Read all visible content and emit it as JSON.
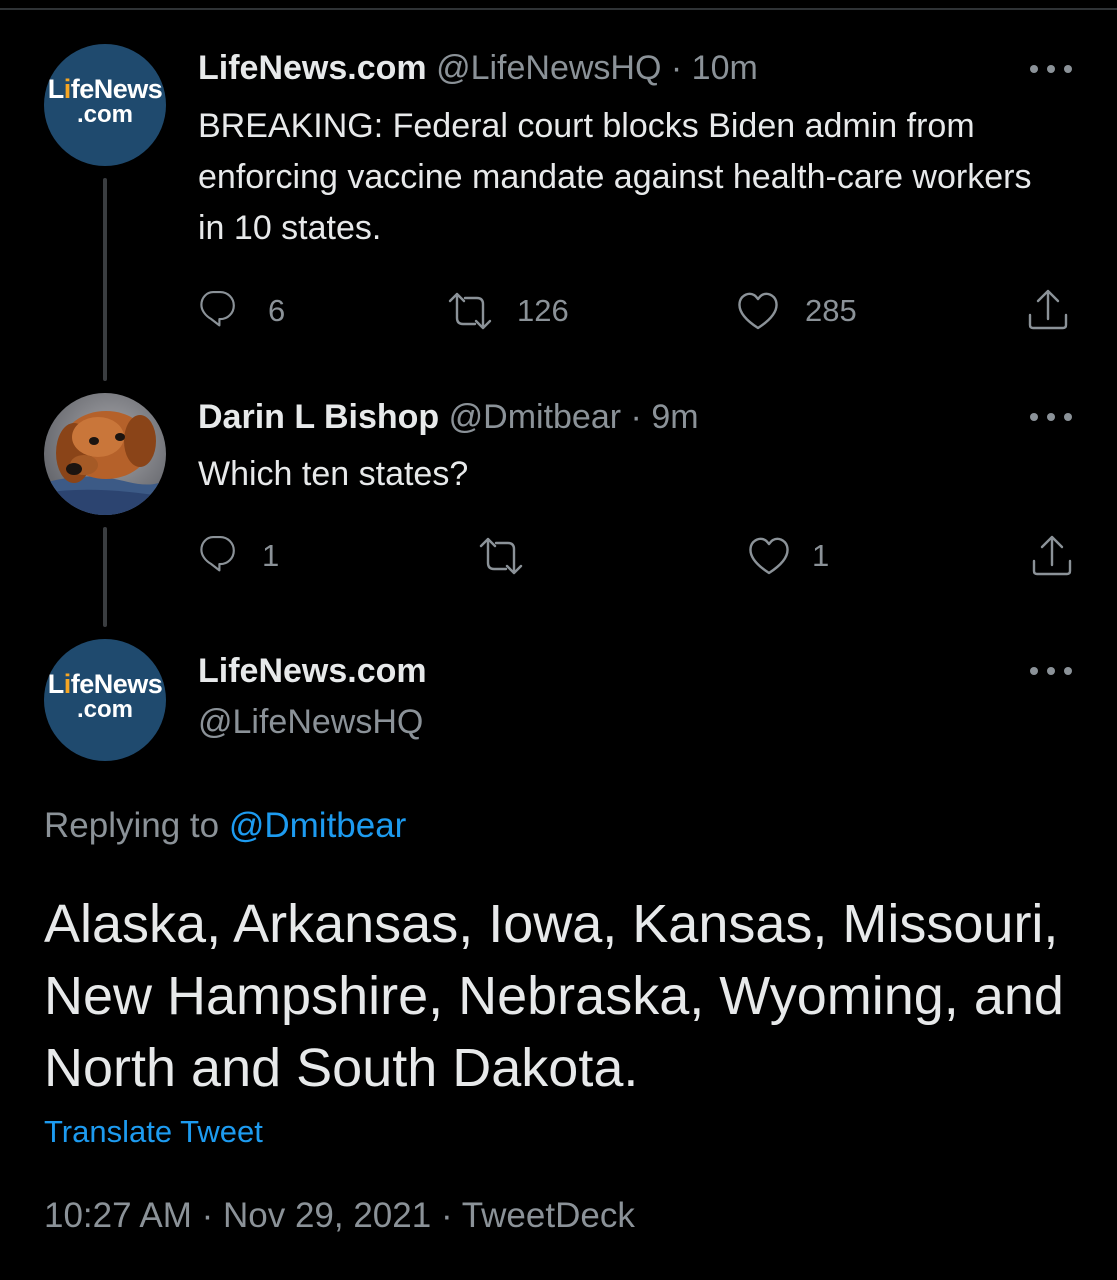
{
  "tweet1": {
    "avatar_line1_a": "L",
    "avatar_line1_b": "i",
    "avatar_line1_c": "feNews",
    "avatar_line2": ".com",
    "name": "LifeNews.com",
    "handle": "@LifeNewsHQ",
    "separator": "·",
    "time": "10m",
    "text": "BREAKING: Federal court blocks Biden admin from enforcing vaccine mandate against health-care workers in 10 states.",
    "reply_count": "6",
    "retweet_count": "126",
    "like_count": "285"
  },
  "tweet2": {
    "name": "Darin L Bishop",
    "handle": "@Dmitbear",
    "separator": "·",
    "time": "9m",
    "text": "Which ten states?",
    "reply_count": "1",
    "retweet_count": "",
    "like_count": "1"
  },
  "tweet3": {
    "avatar_line1_a": "L",
    "avatar_line1_b": "i",
    "avatar_line1_c": "feNews",
    "avatar_line2": ".com",
    "name": "LifeNews.com",
    "handle": "@LifeNewsHQ",
    "replying_prefix": "Replying to ",
    "replying_mention": "@Dmitbear",
    "text": "Alaska, Arkansas, Iowa, Kansas, Missouri, New Hampshire, Nebraska, Wyoming, and North and South Dakota.",
    "translate_label": "Translate Tweet",
    "timestamp": "10:27 AM",
    "separator1": " · ",
    "date": "Nov 29, 2021",
    "separator2": " · ",
    "source": "TweetDeck"
  },
  "icons": {
    "reply": "reply-icon",
    "retweet": "retweet-icon",
    "like": "heart-icon",
    "share": "share-icon",
    "more": "more-icon"
  },
  "colors": {
    "background": "#000000",
    "text": "#e7e9ea",
    "secondary": "#8b9298",
    "link": "#1d9bf0",
    "avatar_bg": "#1f4a6e",
    "avatar_accent": "#f6a623"
  }
}
